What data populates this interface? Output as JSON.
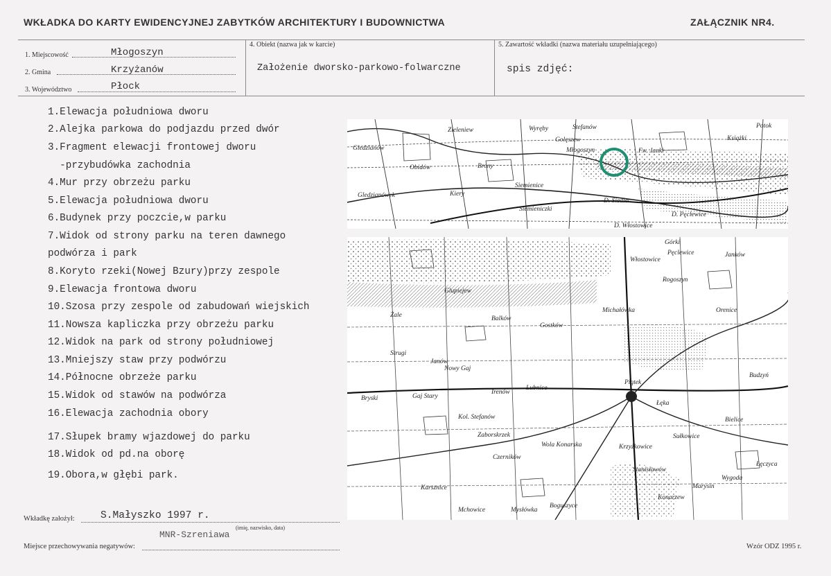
{
  "header": {
    "title": "WKŁADKA DO KARTY EWIDENCYJNEJ ZABYTKÓW ARCHITEKTURY I BUDOWNICTWA",
    "annex": "ZAŁĄCZNIK NR4."
  },
  "fields": {
    "miejscowosc": {
      "label": "1. Miejscowość",
      "value": "Młogoszyn"
    },
    "gmina": {
      "label": "2. Gmina",
      "value": "Krzyżanów"
    },
    "wojewodztwo": {
      "label": "3. Województwo",
      "value": "Płock"
    },
    "obiekt": {
      "label": "4. Obiekt  (nazwa jak w karcie)",
      "value": "Założenie dworsko-parkowo-folwarczne"
    },
    "zawartosc": {
      "label": "5. Zawartość wkładki  (nazwa materiału uzupełniającego)",
      "value": "spis zdjęć:"
    }
  },
  "items": [
    "1.Elewacja południowa dworu",
    "2.Alejka parkowa do podjazdu przed dwór",
    "3.Fragment elewacji frontowej dworu",
    "  -przybudówka zachodnia",
    "4.Mur przy obrzeżu parku",
    "5.Elewacja południowa dworu",
    "6.Budynek przy poczcie,w parku",
    "7.Widok od strony parku na teren dawnego",
    "podwórza i park",
    "8.Koryto rzeki(Nowej Bzury)przy zespole",
    "9.Elewacja frontowa dworu",
    "10.Szosa przy zespole od zabudowań wiejskich",
    "11.Nowsza kapliczka przy obrzeżu parku",
    "12.Widok na park od strony południowej",
    "13.Mniejszy staw przy podwórzu",
    "14.Północne obrzeże parku",
    "15.Widok od stawów na podwórza",
    "16.Elewacja zachodnia obory",
    "17.Słupek bramy wjazdowej do parku",
    "18.Widok od pd.na oborę",
    "19.Obora,w głębi park."
  ],
  "map": {
    "labels": [
      "Stefanów",
      "Wyręby",
      "Zieleniew",
      "Potok",
      "Książki",
      "Golęszew",
      "Młogoszyn",
      "Gledzianów",
      "Brony",
      "Fw. Janki",
      "Obidów",
      "Siemienice",
      "Kiery",
      "Gledzianówek",
      "Siemieniczki",
      "D. Siedlec",
      "D. Pęclewice",
      "D. Włostowice",
      "Górki",
      "Pęclewice",
      "Janków",
      "Włostowice",
      "Rogoszyn",
      "Żale",
      "Glupiejew",
      "Balków",
      "Gostków",
      "Michałówka",
      "Orenice",
      "Janów",
      "Nowy Gaj",
      "Gaj Stary",
      "Strugi",
      "Bryski",
      "Irenów",
      "Lubnice",
      "Piątek",
      "Łęka",
      "Bielice",
      "Kol. Stefanów",
      "Zaborskrzek",
      "Czerników",
      "Sułkowice",
      "Krzyżkowice",
      "Konarzew",
      "Wola Konarska",
      "Boguszyce",
      "Mysłówka",
      "Mchowice",
      "Karsznice",
      "Marysin",
      "Wygoda",
      "Łęczyca",
      "Stanisławów",
      "Budzyń"
    ],
    "marker_color": "#1f8f73"
  },
  "footer": {
    "zalozyl_label": "Wkładkę założył:",
    "zalozyl_value": "S.Małyszko 1997 r.",
    "zalozyl_hint": "(imię, nazwisko, data)",
    "negatywy_label": "Miejsce przechowywania negatywów:",
    "negatywy_value": "MNR-Szreniawa",
    "wzor": "Wzór ODZ 1995 r."
  }
}
